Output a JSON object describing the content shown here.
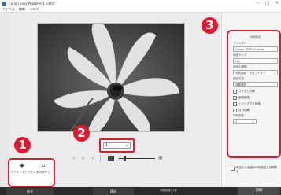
{
  "window": {
    "title": "Canon Easy-PhotoPrint Editor",
    "controls": [
      "─",
      "□",
      "✕"
    ]
  },
  "menu": [
    "ファイル",
    "編集",
    "ヘルプ"
  ],
  "tools": [
    {
      "icon": "ink-drop-icon",
      "glyph": "◈",
      "label": "オートフォトフィニッシャー"
    },
    {
      "icon": "crop-icon",
      "glyph": "⌗",
      "label": "トリミング"
    }
  ],
  "page_select": {
    "value": "1"
  },
  "zoom": {
    "level": 0.15
  },
  "sidebar": {
    "title": "印刷設定",
    "fields": [
      {
        "label": "プリンター",
        "value": "Canon TS8200 series"
      },
      {
        "label": "用紙サイズ",
        "value": "L判"
      },
      {
        "label": "用紙の種類",
        "value": "写真用紙・光沢ゴールド"
      },
      {
        "label": "給紙方法",
        "value": "自動選択"
      }
    ],
    "checks": [
      "フチなし印刷",
      "画質優先",
      "シャープさを強調",
      "日付印刷"
    ],
    "copies_label": "印刷部数",
    "copies_value": "1"
  },
  "side_note": "次回から画面の印刷設定を使用する",
  "bottom": {
    "left_label": "戻る",
    "mid_label": "保存",
    "status": "印刷部数: 1部",
    "print_label": "印刷"
  },
  "badges": {
    "one": "1",
    "two": "2",
    "three": "3"
  },
  "colors": {
    "callout": "#e8162f"
  }
}
